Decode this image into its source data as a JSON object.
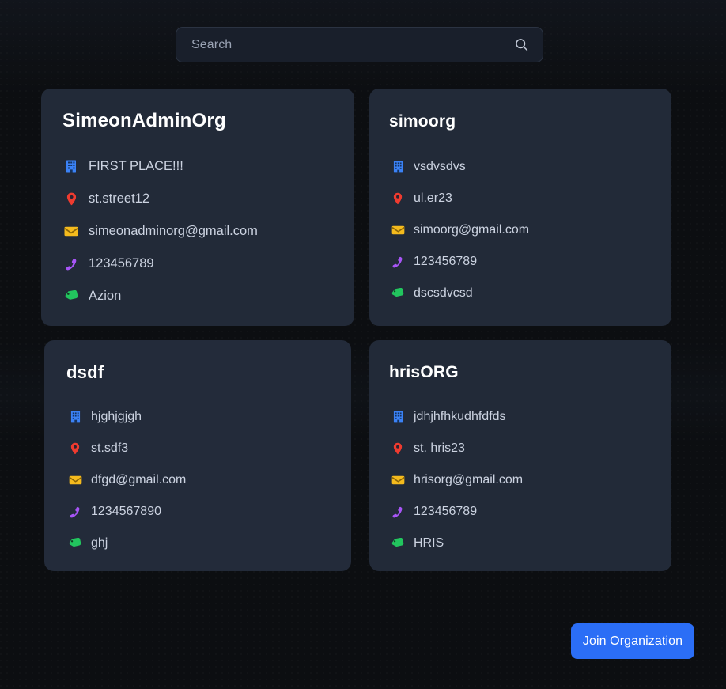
{
  "search": {
    "placeholder": "Search",
    "value": "",
    "icon": "search-icon"
  },
  "organizations": [
    {
      "name": "SimeonAdminOrg",
      "rows": [
        {
          "icon": "office-building-icon",
          "label": "FIRST PLACE!!!"
        },
        {
          "icon": "location-pin-icon",
          "label": "st.street12"
        },
        {
          "icon": "envelope-icon",
          "label": "simeonadminorg@gmail.com"
        },
        {
          "icon": "phone-icon",
          "label": "123456789"
        },
        {
          "icon": "tag-icon",
          "label": "Azion"
        }
      ]
    },
    {
      "name": "simoorg",
      "rows": [
        {
          "icon": "office-building-icon",
          "label": "vsdvsdvs"
        },
        {
          "icon": "location-pin-icon",
          "label": "ul.er23"
        },
        {
          "icon": "envelope-icon",
          "label": "simoorg@gmail.com"
        },
        {
          "icon": "phone-icon",
          "label": "123456789"
        },
        {
          "icon": "tag-icon",
          "label": "dscsdvcsd"
        }
      ]
    },
    {
      "name": "dsdf",
      "rows": [
        {
          "icon": "office-building-icon",
          "label": "hjghjgjgh"
        },
        {
          "icon": "location-pin-icon",
          "label": "st.sdf3"
        },
        {
          "icon": "envelope-icon",
          "label": "dfgd@gmail.com"
        },
        {
          "icon": "phone-icon",
          "label": "1234567890"
        },
        {
          "icon": "tag-icon",
          "label": "ghj"
        }
      ]
    },
    {
      "name": "hrisORG",
      "rows": [
        {
          "icon": "office-building-icon",
          "label": "jdhjhfhkudhfdfds"
        },
        {
          "icon": "location-pin-icon",
          "label": "st. hris23"
        },
        {
          "icon": "envelope-icon",
          "label": "hrisorg@gmail.com"
        },
        {
          "icon": "phone-icon",
          "label": "123456789"
        },
        {
          "icon": "tag-icon",
          "label": "HRIS"
        }
      ]
    }
  ],
  "actions": {
    "join_label": "Join Organization"
  },
  "colors": {
    "page_background": "#0c0e11",
    "card_background": "#222a38",
    "search_background": "#191f2b",
    "accent_button": "#2b6ef6",
    "text_primary": "#ffffff",
    "text_secondary": "#ccd3e1",
    "icon_building": "#3b82f6",
    "icon_pin": "#ef3b2f",
    "icon_envelope": "#f5bb1d",
    "icon_phone": "#a855f7",
    "icon_tag": "#22c55e"
  }
}
